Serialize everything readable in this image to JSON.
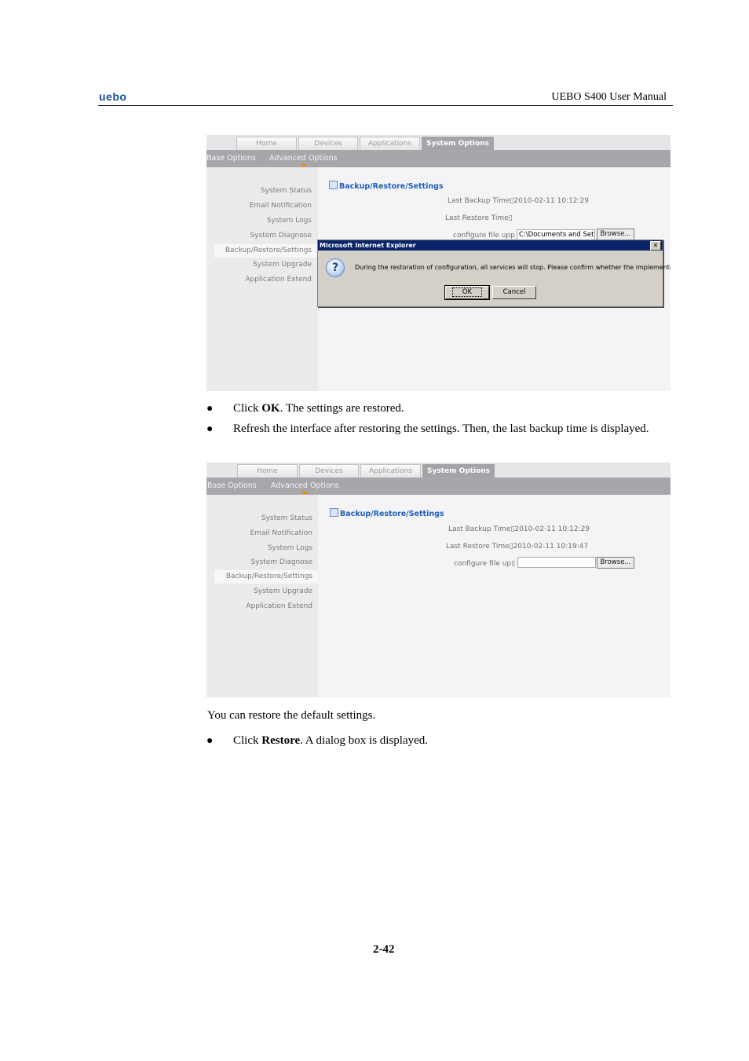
{
  "header": {
    "logo": "uebo",
    "title": "UEBO S400 User Manual"
  },
  "screenshot1": {
    "tabs": [
      "Home",
      "Devices",
      "Applications",
      "System Options"
    ],
    "subtabs": [
      "Base Options",
      "Advanced Options"
    ],
    "sidebar": [
      "System Status",
      "Email Notification",
      "System Logs",
      "System Diagnose",
      "Backup/Restore/Settings",
      "System Upgrade",
      "Application Extend"
    ],
    "section_title": "Backup/Restore/Settings",
    "last_backup": "Last Backup Time▯2010-02-11 10:12:29",
    "last_restore": "Last Restore Time▯",
    "configure_label": "configure file upp",
    "file_value": "C:\\Documents and Sett",
    "browse": "Browse...",
    "dialog": {
      "title": "Microsoft Internet Explorer",
      "close": "✕",
      "icon": "?",
      "message": "During the restoration of configuration, all services will stop. Please confirm whether the implementation of.",
      "ok": "OK",
      "cancel": "Cancel"
    }
  },
  "bullets1": [
    {
      "prefix": "Click ",
      "bold": "OK",
      "suffix": ". The settings are restored."
    },
    {
      "text": "Refresh the interface after restoring the settings. Then, the last backup time is displayed."
    }
  ],
  "screenshot2": {
    "tabs": [
      "Home",
      "Devices",
      "Applications",
      "System Options"
    ],
    "subtabs": [
      "Base Options",
      "Advanced Options"
    ],
    "sidebar": [
      "System Status",
      "Email Notification",
      "System Logs",
      "System Diagnose",
      "Backup/Restore/Settings",
      "System Upgrade",
      "Application Extend"
    ],
    "section_title": "Backup/Restore/Settings",
    "last_backup": "Last Backup Time▯2010-02-11 10:12:29",
    "last_restore": "Last Restore Time▯2010-02-11 10:19:47",
    "configure_label": "configure file up▯",
    "file_value": "",
    "browse": "Browse..."
  },
  "paragraph": "You can restore the default settings.",
  "bullets2": [
    {
      "prefix": "Click ",
      "bold": "Restore",
      "suffix": ". A dialog box is displayed."
    }
  ],
  "page_number": "2-42"
}
